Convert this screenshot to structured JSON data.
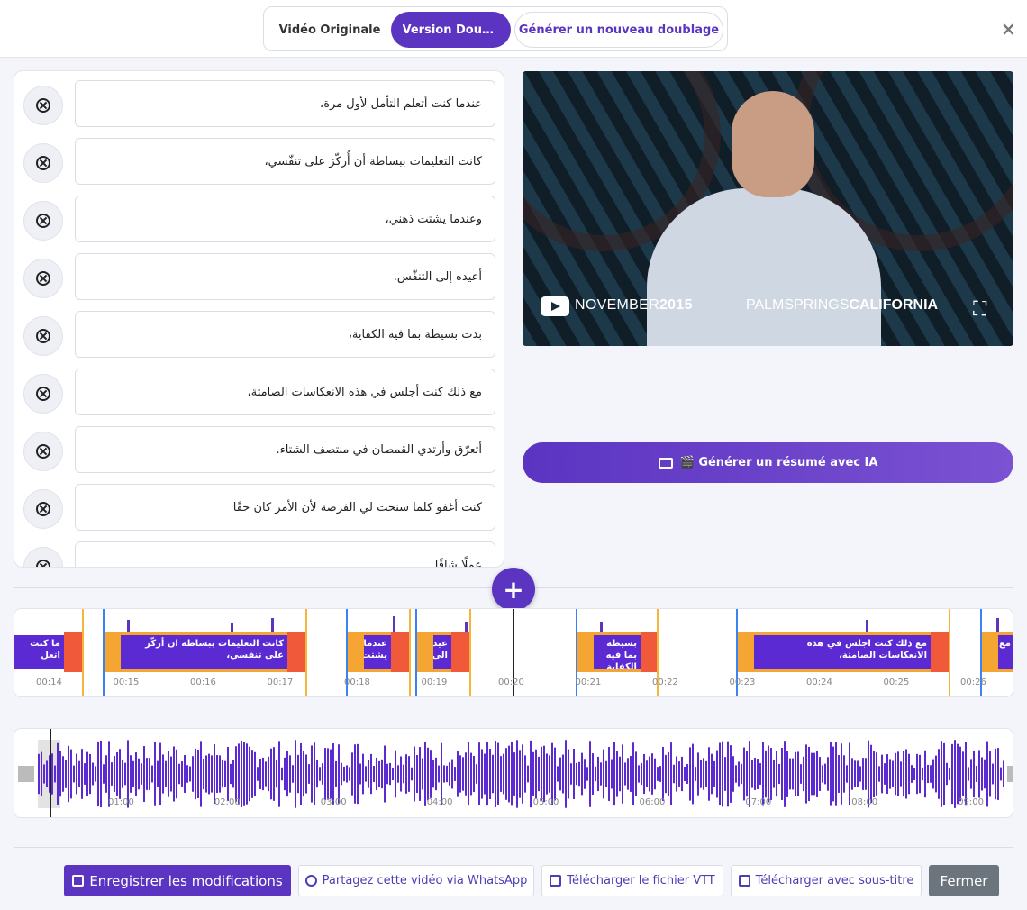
{
  "tabs": {
    "original": "Vidéo Originale",
    "dubbed": "Version Doublée",
    "new_dub": "Générer un nouveau doublage"
  },
  "close_symbol": "×",
  "segments": [
    "عندما كنت أتعلم التأمل لأول مرة،",
    "كانت التعليمات ببساطة أن أُركّز على تنفّسي،",
    "وعندما يشتت ذهني،",
    "أعيده إلى التنفّس.",
    "بدت بسيطة بما فيه الكفاية،",
    "مع ذلك كنت أجلس في هذه الانعكاسات الصامتة،",
    "أتعرّق وأرتدي القمصان في منتصف الشتاء.",
    "كنت أغفو كلما سنحت لي الفرصة لأن الأمر كان حقًا",
    "عملًا شاقًا"
  ],
  "video": {
    "caption_left_a": "NOVEMBER",
    "caption_left_b": "2015",
    "caption_right_a": "PALMSPRINGS",
    "caption_right_b": "CALIFORNIA",
    "fullscreen_icon": "⛶"
  },
  "ai_button": "🎬 Générer un résumé avec IA",
  "add_symbol": "+",
  "timeline": {
    "ticks": [
      "00:14",
      "00:15",
      "00:16",
      "00:17",
      "00:18",
      "00:19",
      "00:20",
      "00:21",
      "00:22",
      "00:23",
      "00:24",
      "00:25",
      "00:26"
    ],
    "blocks": [
      "ما كنت اتعل",
      "كانت التعليمات ببساطة ان أركّز على تنفسي،",
      "عندما يشتت",
      "عيده الى",
      "بسيطة بما فيه الكفاية",
      "مع ذلك كنت اجلس في هذه الانعكاسات الصامتة،",
      "مع"
    ]
  },
  "waveform": {
    "ticks": [
      "01:00",
      "02:00",
      "03:00",
      "04:00",
      "05:00",
      "06:00",
      "07:00",
      "08:00",
      "09:00"
    ]
  },
  "buttons": {
    "save": "Enregistrer les modifications",
    "whatsapp": "Partagez cette vidéo via WhatsApp",
    "vtt": "Télécharger le fichier VTT",
    "subtitle": "Télécharger avec sous-titre",
    "close": "Fermer"
  },
  "colors": {
    "accent": "#5b34c2",
    "timeline_orange": "#f5a531",
    "timeline_red": "#f05a3a",
    "close_gray": "#6c757d"
  }
}
